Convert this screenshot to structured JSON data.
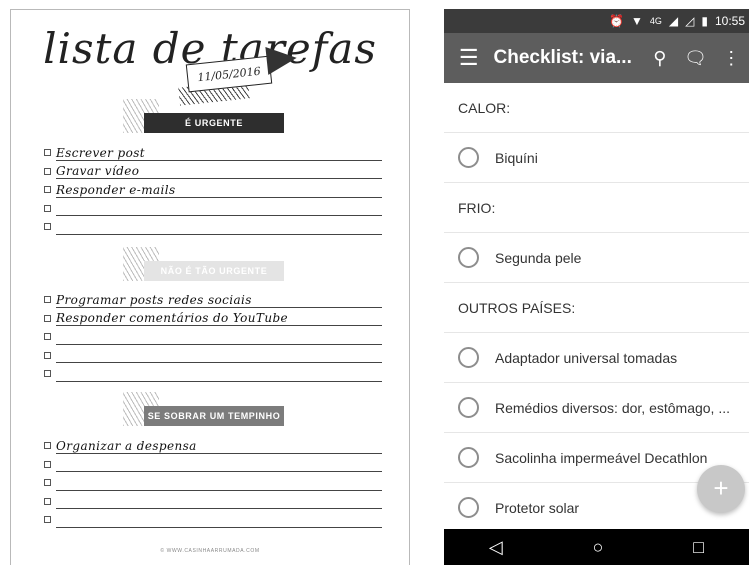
{
  "sheet": {
    "title": "lista de tarefas",
    "date": "11/05/2016",
    "sections": [
      {
        "heading": "É URGENTE",
        "tasks": [
          "Escrever post",
          "Gravar vídeo",
          "Responder e-mails",
          "",
          ""
        ]
      },
      {
        "heading": "NÃO É TÃO URGENTE",
        "tasks": [
          "Programar posts redes sociais",
          "Responder comentários do YouTube",
          "",
          "",
          ""
        ]
      },
      {
        "heading": "SE SOBRAR UM TEMPINHO",
        "tasks": [
          "Organizar a despensa",
          "",
          "",
          "",
          ""
        ]
      }
    ],
    "footer": "© WWW.CASINHAARRUMADA.COM"
  },
  "phone": {
    "status": {
      "alarm_icon": "alarm-icon",
      "wifi_icon": "wifi-icon",
      "network": "4G",
      "signal_icon": "signal-icon",
      "battery_icon": "battery-icon",
      "time": "10:55"
    },
    "appbar": {
      "menu_icon": "☰",
      "title": "Checklist: via...",
      "search_icon": "⚲",
      "comment_icon": "🗨",
      "more_icon": "⋮"
    },
    "list": [
      {
        "kind": "header",
        "text": "CALOR:"
      },
      {
        "kind": "item",
        "text": "Biquíni"
      },
      {
        "kind": "header",
        "text": "FRIO:"
      },
      {
        "kind": "item",
        "text": "Segunda pele"
      },
      {
        "kind": "header",
        "text": "OUTROS PAÍSES:"
      },
      {
        "kind": "item",
        "text": "Adaptador universal tomadas"
      },
      {
        "kind": "item",
        "text": "Remédios diversos: dor, estômago, ..."
      },
      {
        "kind": "item",
        "text": "Sacolinha impermeável Decathlon"
      },
      {
        "kind": "item",
        "text": "Protetor solar"
      }
    ],
    "fab": "+",
    "nav": {
      "back": "◁",
      "home": "○",
      "recents": "□"
    },
    "colors": {
      "statusbar": "#3b3b3b",
      "appbar": "#5d5d5d",
      "fab": "#c8c8c8"
    }
  }
}
